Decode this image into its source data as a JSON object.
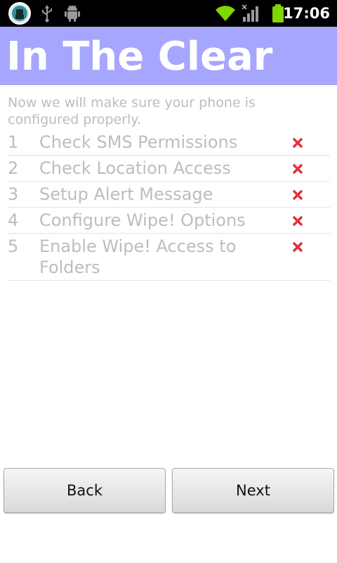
{
  "status_bar": {
    "time": "17:06",
    "icons": [
      "app-notification-icon",
      "usb-icon",
      "android-debug-icon",
      "wifi-icon",
      "cell-signal-icon",
      "battery-icon"
    ],
    "accent_color": "#7fd600"
  },
  "header": {
    "title": "In The Clear",
    "background_color": "#a6a6ff"
  },
  "intro_text": "Now we will make sure your phone is configured properly.",
  "steps": [
    {
      "number": "1",
      "label": "Check SMS Permissions",
      "status": "incomplete"
    },
    {
      "number": "2",
      "label": "Check Location Access",
      "status": "incomplete"
    },
    {
      "number": "3",
      "label": "Setup Alert Message",
      "status": "incomplete"
    },
    {
      "number": "4",
      "label": "Configure Wipe! Options",
      "status": "incomplete"
    },
    {
      "number": "5",
      "label": "Enable Wipe! Access to Folders",
      "status": "incomplete"
    }
  ],
  "status_icon_color": "#e0313a",
  "buttons": {
    "back_label": "Back",
    "next_label": "Next"
  }
}
